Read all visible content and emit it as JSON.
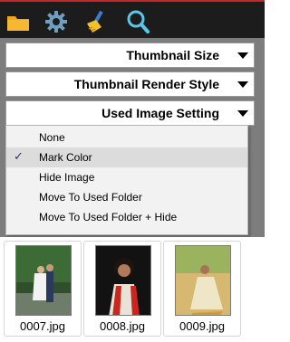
{
  "toolbar": {
    "buttons": [
      {
        "name": "open-folder-icon"
      },
      {
        "name": "settings-gear-icon"
      },
      {
        "name": "clean-brush-icon"
      },
      {
        "name": "search-icon"
      }
    ]
  },
  "dropdowns": {
    "thumbnail_size": "Thumbnail Size",
    "render_style": "Thumbnail Render Style",
    "used_image_setting": "Used Image Setting"
  },
  "menu": {
    "items": [
      {
        "label": "None",
        "checked": false
      },
      {
        "label": "Mark Color",
        "checked": true
      },
      {
        "label": "Hide Image",
        "checked": false
      },
      {
        "label": "Move To Used Folder",
        "checked": false
      },
      {
        "label": "Move To Used Folder + Hide",
        "checked": false
      }
    ],
    "check_glyph": "✓"
  },
  "thumbnails": [
    {
      "file": "0007.jpg"
    },
    {
      "file": "0008.jpg"
    },
    {
      "file": "0009.jpg"
    }
  ],
  "colors": {
    "toolbar_bg": "#1c1c1c",
    "accent_red": "#c0282c",
    "panel_gray": "#7d7d7d",
    "menu_bg": "#f2f2f2"
  }
}
